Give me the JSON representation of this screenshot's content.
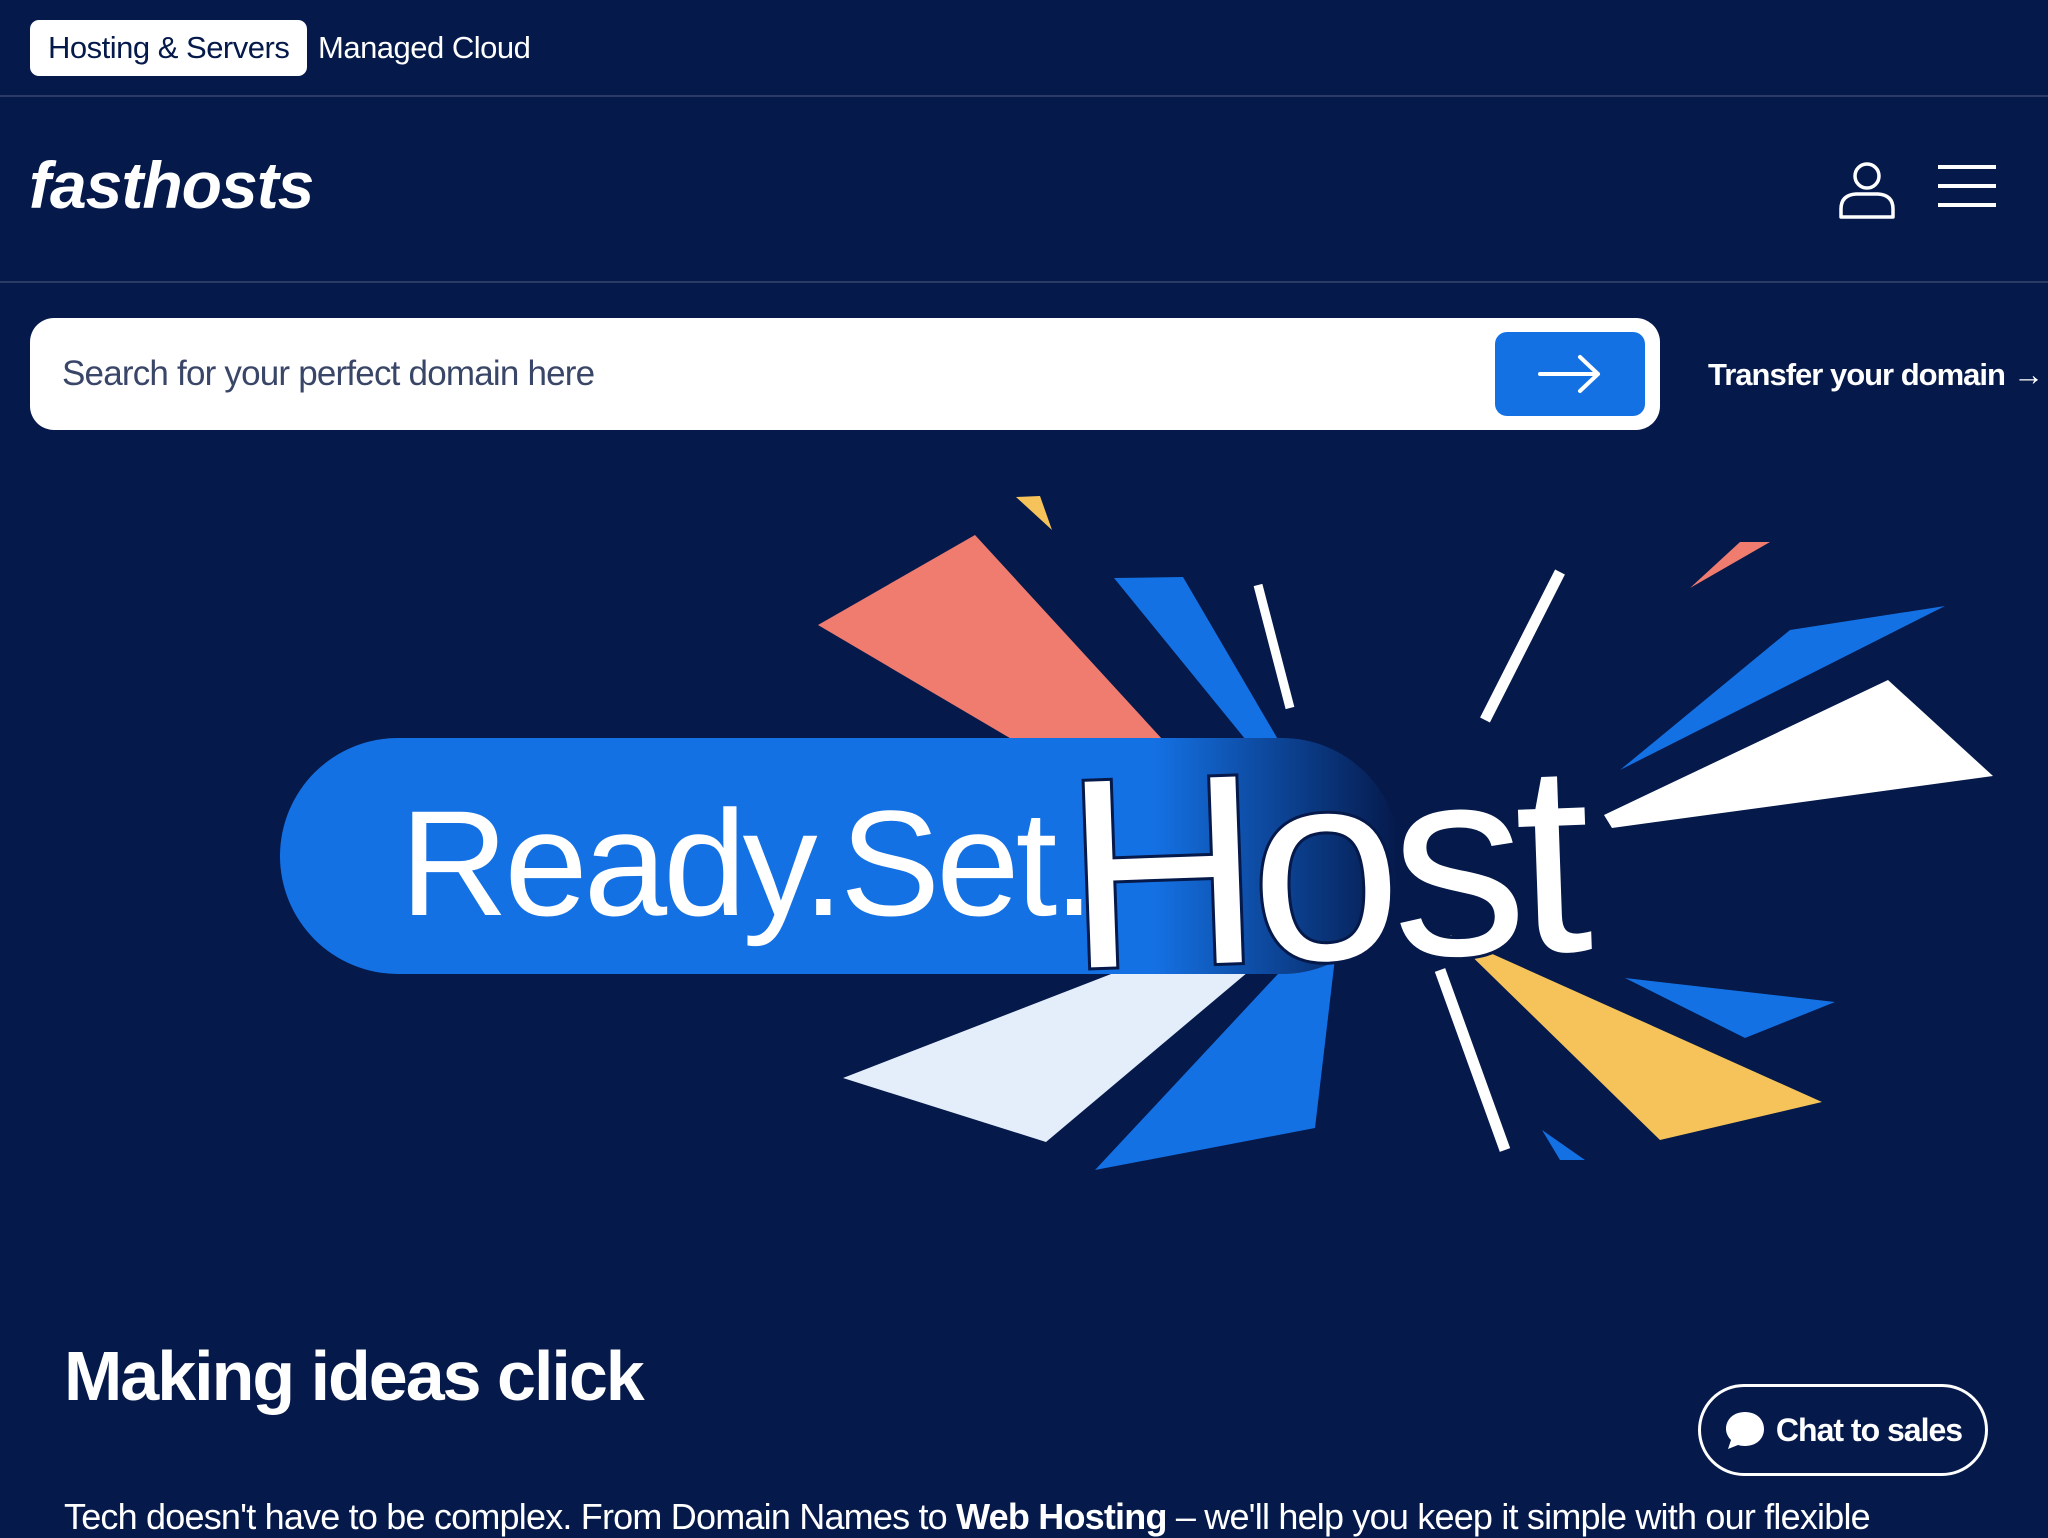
{
  "tabs": [
    {
      "label": "Hosting & Servers",
      "active": true
    },
    {
      "label": "Managed Cloud",
      "active": false
    }
  ],
  "header": {
    "logo": "fasthosts",
    "account_icon": "user-icon",
    "menu_icon": "hamburger-menu-icon"
  },
  "search": {
    "placeholder": "Search for your perfect domain here",
    "value": "",
    "button_icon": "arrow-right-icon"
  },
  "transfer": {
    "label": "Transfer your domain",
    "arrow": "→"
  },
  "hero": {
    "text_prefix": "Ready.Set.",
    "text_emphasis": "Host"
  },
  "section": {
    "headline": "Making ideas click",
    "body_start": "Tech doesn't have to be complex. From Domain Names to ",
    "body_bold": "Web Hosting",
    "body_end": " – we'll help you keep it simple with our flexible"
  },
  "chat": {
    "label": "Chat to sales",
    "icon": "chat-bubble-icon"
  },
  "colors": {
    "background": "#05194a",
    "accent_blue": "#1471e4",
    "coral": "#f07c70",
    "yellow": "#f5c35a",
    "pale_blue": "#e3eefa",
    "divider": "#2a3b66"
  }
}
